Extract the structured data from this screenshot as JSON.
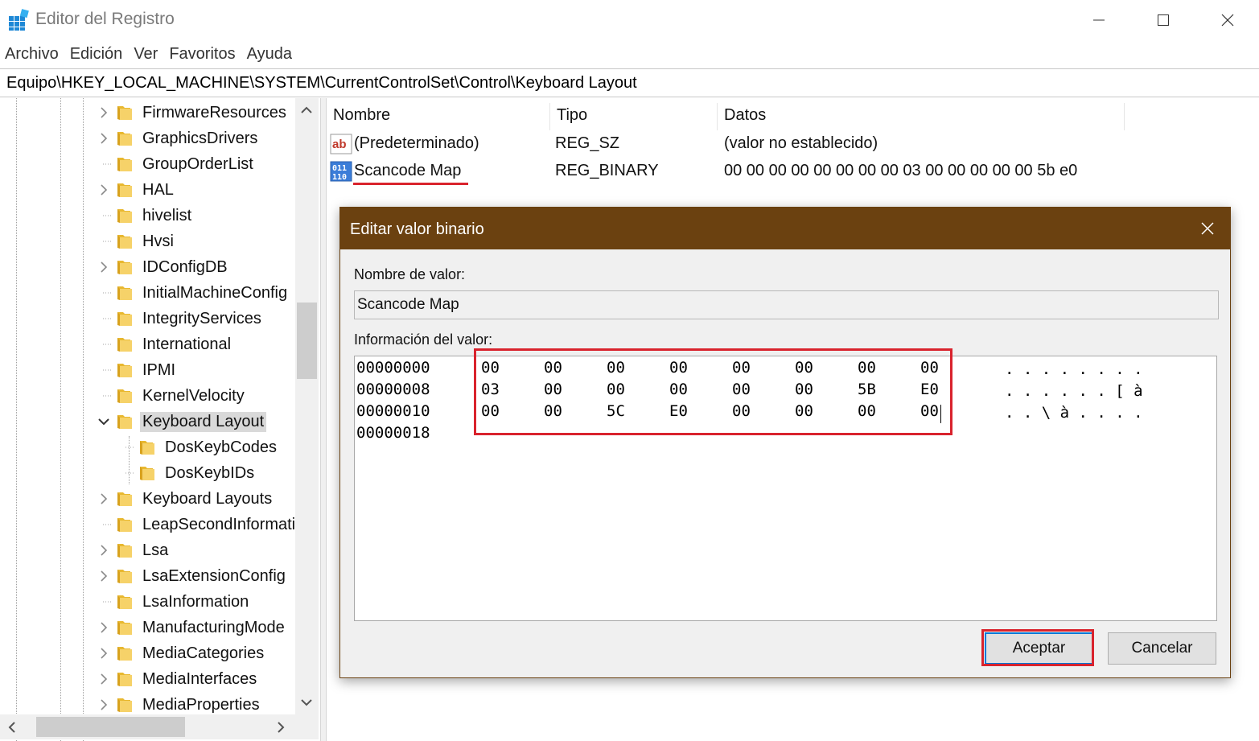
{
  "window": {
    "title": "Editor del Registro",
    "controls": [
      "minimize-icon",
      "maximize-icon",
      "close-icon"
    ]
  },
  "menu": [
    "Archivo",
    "Edición",
    "Ver",
    "Favoritos",
    "Ayuda"
  ],
  "address": "Equipo\\HKEY_LOCAL_MACHINE\\SYSTEM\\CurrentControlSet\\Control\\Keyboard Layout",
  "tree": {
    "items": [
      {
        "label": "FirmwareResources",
        "expandable": true,
        "level": 1
      },
      {
        "label": "GraphicsDrivers",
        "expandable": true,
        "level": 1
      },
      {
        "label": "GroupOrderList",
        "expandable": false,
        "level": 1
      },
      {
        "label": "HAL",
        "expandable": true,
        "level": 1
      },
      {
        "label": "hivelist",
        "expandable": false,
        "level": 1
      },
      {
        "label": "Hvsi",
        "expandable": false,
        "level": 1
      },
      {
        "label": "IDConfigDB",
        "expandable": true,
        "level": 1
      },
      {
        "label": "InitialMachineConfig",
        "expandable": false,
        "level": 1
      },
      {
        "label": "IntegrityServices",
        "expandable": false,
        "level": 1
      },
      {
        "label": "International",
        "expandable": false,
        "level": 1
      },
      {
        "label": "IPMI",
        "expandable": false,
        "level": 1
      },
      {
        "label": "KernelVelocity",
        "expandable": false,
        "level": 1
      },
      {
        "label": "Keyboard Layout",
        "expandable": true,
        "expanded": true,
        "selected": true,
        "level": 1
      },
      {
        "label": "DosKeybCodes",
        "expandable": false,
        "level": 2
      },
      {
        "label": "DosKeybIDs",
        "expandable": false,
        "level": 2
      },
      {
        "label": "Keyboard Layouts",
        "expandable": true,
        "level": 1
      },
      {
        "label": "LeapSecondInformation",
        "expandable": false,
        "level": 1
      },
      {
        "label": "Lsa",
        "expandable": true,
        "level": 1
      },
      {
        "label": "LsaExtensionConfig",
        "expandable": true,
        "level": 1
      },
      {
        "label": "LsaInformation",
        "expandable": false,
        "level": 1
      },
      {
        "label": "ManufacturingMode",
        "expandable": true,
        "level": 1
      },
      {
        "label": "MediaCategories",
        "expandable": true,
        "level": 1
      },
      {
        "label": "MediaInterfaces",
        "expandable": true,
        "level": 1
      },
      {
        "label": "MediaProperties",
        "expandable": true,
        "level": 1
      }
    ]
  },
  "list": {
    "columns": [
      "Nombre",
      "Tipo",
      "Datos"
    ],
    "rows": [
      {
        "icon": "string-value-icon",
        "name": "(Predeterminado)",
        "type": "REG_SZ",
        "data": "(valor no establecido)"
      },
      {
        "icon": "binary-value-icon",
        "name": "Scancode Map",
        "type": "REG_BINARY",
        "data": "00 00 00 00 00 00 00 00 03 00 00 00 00 00 5b e0"
      }
    ]
  },
  "dialog": {
    "title": "Editar valor binario",
    "name_label": "Nombre de valor:",
    "name_value": "Scancode Map",
    "info_label": "Información del valor:",
    "hex_lines": [
      {
        "offset": "00000000",
        "bytes": [
          "00",
          "00",
          "00",
          "00",
          "00",
          "00",
          "00",
          "00"
        ],
        "ascii": ". . . . . . . ."
      },
      {
        "offset": "00000008",
        "bytes": [
          "03",
          "00",
          "00",
          "00",
          "00",
          "00",
          "5B",
          "E0"
        ],
        "ascii": ". . . . . . [ à"
      },
      {
        "offset": "00000010",
        "bytes": [
          "00",
          "00",
          "5C",
          "E0",
          "00",
          "00",
          "00",
          "00"
        ],
        "ascii": ". . \\ à . . . ."
      },
      {
        "offset": "00000018",
        "bytes": [],
        "ascii": ""
      }
    ],
    "ok_label": "Aceptar",
    "cancel_label": "Cancelar"
  },
  "colors": {
    "dialog_title_bg": "#6b4110",
    "highlight": "#d9232d",
    "folder": "#f0c34a"
  }
}
